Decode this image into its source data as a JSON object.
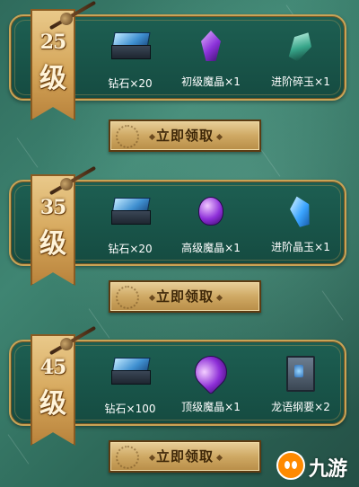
{
  "tiers": [
    {
      "level_number": "25",
      "level_unit": "级",
      "rewards": [
        {
          "label": "钻石×20",
          "icon": "diamond-chest-icon"
        },
        {
          "label": "初级魔晶×1",
          "icon": "purple-crystal-icon"
        },
        {
          "label": "进阶碎玉×1",
          "icon": "jade-shard-icon"
        }
      ],
      "claim_label": "立即领取"
    },
    {
      "level_number": "35",
      "level_unit": "级",
      "rewards": [
        {
          "label": "钻石×20",
          "icon": "diamond-chest-icon"
        },
        {
          "label": "高级魔晶×1",
          "icon": "purple-gem-icon"
        },
        {
          "label": "进阶晶玉×1",
          "icon": "blue-crystal-icon"
        }
      ],
      "claim_label": "立即领取"
    },
    {
      "level_number": "45",
      "level_unit": "级",
      "rewards": [
        {
          "label": "钻石×100",
          "icon": "diamond-chest-icon"
        },
        {
          "label": "顶级魔晶×1",
          "icon": "purple-teardrop-gem-icon"
        },
        {
          "label": "龙语纲要×2",
          "icon": "dragon-book-icon"
        }
      ],
      "claim_label": "立即领取"
    }
  ],
  "watermark": {
    "text": "九游",
    "icon": "jiuyou-logo-icon"
  },
  "colors": {
    "background": "#2f6b5c",
    "panel": "#1d5f52",
    "gold_border": "#c9a356",
    "badge": "#d5a65a",
    "button": "#cfa964",
    "button_text": "#3e2708"
  }
}
